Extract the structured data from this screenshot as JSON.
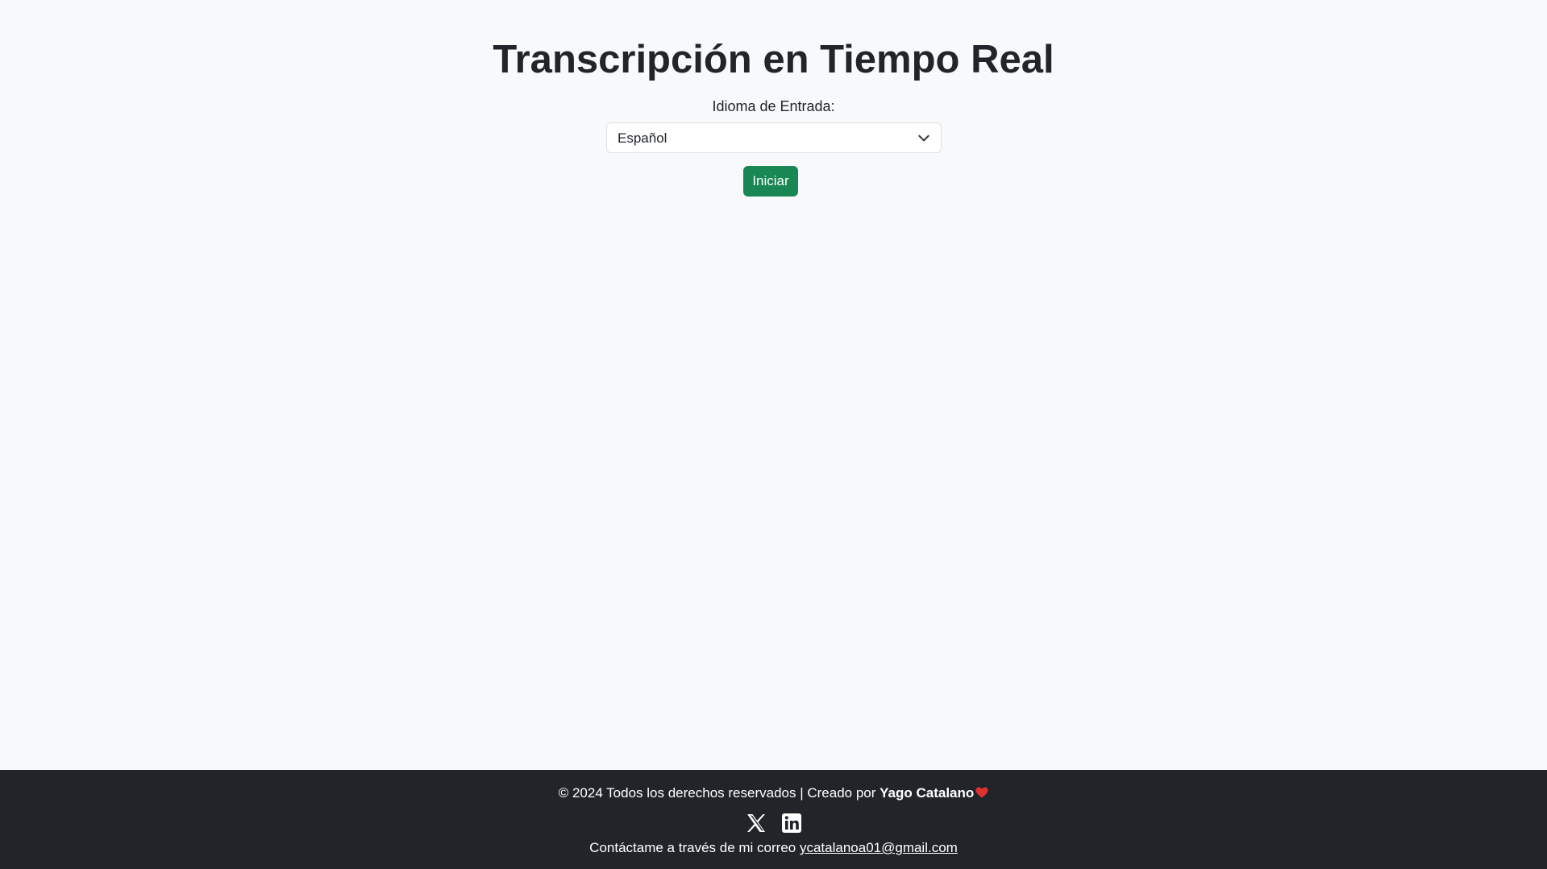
{
  "main": {
    "title": "Transcripción en Tiempo Real",
    "language_label": "Idioma de Entrada:",
    "language_select": {
      "selected": "Español"
    },
    "start_button_label": "Iniciar"
  },
  "footer": {
    "copyright_prefix": "© 2024 Todos los derechos reservados | Creado por",
    "author": "Yago Catalano",
    "contact_prefix": "Contáctame a través de mi correo",
    "email": "ycatalanoa01@gmail.com",
    "social_icons": [
      "x-icon",
      "linkedin-icon"
    ]
  },
  "colors": {
    "background": "#f8f9fa",
    "footer_bg": "#212529",
    "button_bg": "#198754",
    "heart": "#e03131"
  }
}
